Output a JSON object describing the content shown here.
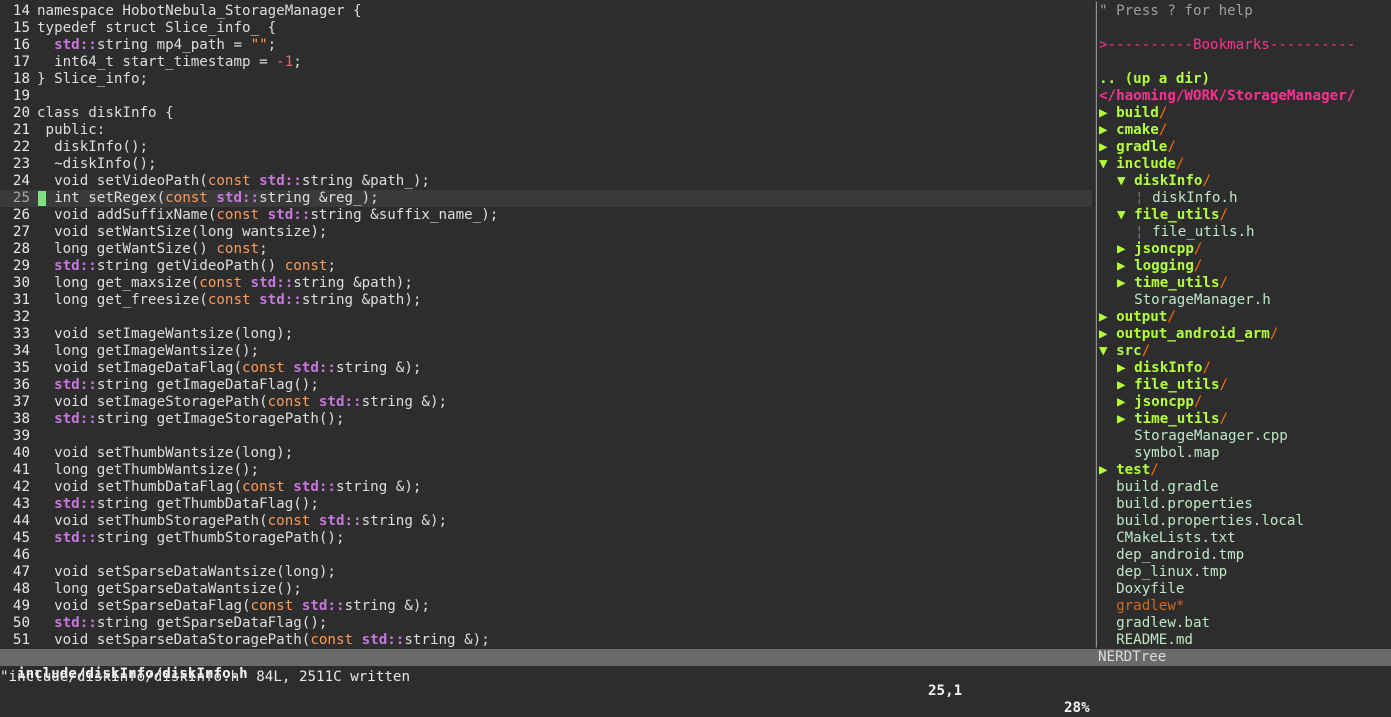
{
  "editor": {
    "current_line": 25,
    "lines": [
      {
        "n": "14",
        "code": "namespace HobotNebula_StorageManager {"
      },
      {
        "n": "15",
        "code": "typedef struct Slice_info_ {"
      },
      {
        "n": "16",
        "code": "  std::string mp4_path = \"\";"
      },
      {
        "n": "17",
        "code": "  int64_t start_timestamp = -1;"
      },
      {
        "n": "18",
        "code": "} Slice_info;"
      },
      {
        "n": "19",
        "code": ""
      },
      {
        "n": "20",
        "code": "class diskInfo {"
      },
      {
        "n": "21",
        "code": " public:"
      },
      {
        "n": "22",
        "code": "  diskInfo();"
      },
      {
        "n": "23",
        "code": "  ~diskInfo();"
      },
      {
        "n": "24",
        "code": "  void setVideoPath(const std::string &path_);"
      },
      {
        "n": "25",
        "code": "  int setRegex(const std::string &reg_);"
      },
      {
        "n": "26",
        "code": "  void addSuffixName(const std::string &suffix_name_);"
      },
      {
        "n": "27",
        "code": "  void setWantSize(long wantsize);"
      },
      {
        "n": "28",
        "code": "  long getWantSize() const;"
      },
      {
        "n": "29",
        "code": "  std::string getVideoPath() const;"
      },
      {
        "n": "30",
        "code": "  long get_maxsize(const std::string &path);"
      },
      {
        "n": "31",
        "code": "  long get_freesize(const std::string &path);"
      },
      {
        "n": "32",
        "code": ""
      },
      {
        "n": "33",
        "code": "  void setImageWantsize(long);"
      },
      {
        "n": "34",
        "code": "  long getImageWantsize();"
      },
      {
        "n": "35",
        "code": "  void setImageDataFlag(const std::string &);"
      },
      {
        "n": "36",
        "code": "  std::string getImageDataFlag();"
      },
      {
        "n": "37",
        "code": "  void setImageStoragePath(const std::string &);"
      },
      {
        "n": "38",
        "code": "  std::string getImageStoragePath();"
      },
      {
        "n": "39",
        "code": ""
      },
      {
        "n": "40",
        "code": "  void setThumbWantsize(long);"
      },
      {
        "n": "41",
        "code": "  long getThumbWantsize();"
      },
      {
        "n": "42",
        "code": "  void setThumbDataFlag(const std::string &);"
      },
      {
        "n": "43",
        "code": "  std::string getThumbDataFlag();"
      },
      {
        "n": "44",
        "code": "  void setThumbStoragePath(const std::string &);"
      },
      {
        "n": "45",
        "code": "  std::string getThumbStoragePath();"
      },
      {
        "n": "46",
        "code": ""
      },
      {
        "n": "47",
        "code": "  void setSparseDataWantsize(long);"
      },
      {
        "n": "48",
        "code": "  long getSparseDataWantsize();"
      },
      {
        "n": "49",
        "code": "  void setSparseDataFlag(const std::string &);"
      },
      {
        "n": "50",
        "code": "  std::string getSparseDataFlag();"
      },
      {
        "n": "51",
        "code": "  void setSparseDataStoragePath(const std::string &);"
      }
    ]
  },
  "tree": {
    "help": "\" Press ? for help",
    "bookmarks": ">----------Bookmarks----------",
    "up_dir": ".. (up a dir)",
    "root": "</haoming/WORK/StorageManager/",
    "items": [
      {
        "kind": "dir",
        "arrow": "▶",
        "name": "build",
        "depth": 0,
        "row": 6
      },
      {
        "kind": "dir",
        "arrow": "▶",
        "name": "cmake",
        "depth": 0,
        "row": 7
      },
      {
        "kind": "dir",
        "arrow": "▶",
        "name": "gradle",
        "depth": 0,
        "row": 8
      },
      {
        "kind": "dir",
        "arrow": "▼",
        "name": "include",
        "depth": 0,
        "row": 9
      },
      {
        "kind": "dir",
        "arrow": "▼",
        "name": "diskInfo",
        "depth": 1,
        "row": 10
      },
      {
        "kind": "file",
        "name": "diskInfo.h",
        "depth": 2,
        "row": 11,
        "guide": true
      },
      {
        "kind": "dir",
        "arrow": "▼",
        "name": "file_utils",
        "depth": 1,
        "row": 12
      },
      {
        "kind": "file",
        "name": "file_utils.h",
        "depth": 2,
        "row": 13,
        "guide": true
      },
      {
        "kind": "dir",
        "arrow": "▶",
        "name": "jsoncpp",
        "depth": 1,
        "row": 14
      },
      {
        "kind": "dir",
        "arrow": "▶",
        "name": "logging",
        "depth": 1,
        "row": 15
      },
      {
        "kind": "dir",
        "arrow": "▶",
        "name": "time_utils",
        "depth": 1,
        "row": 16
      },
      {
        "kind": "file",
        "name": "StorageManager.h",
        "depth": 1,
        "row": 17
      },
      {
        "kind": "dir",
        "arrow": "▶",
        "name": "output",
        "depth": 0,
        "row": 18
      },
      {
        "kind": "dir",
        "arrow": "▶",
        "name": "output_android_arm",
        "depth": 0,
        "row": 19
      },
      {
        "kind": "dir",
        "arrow": "▼",
        "name": "src",
        "depth": 0,
        "row": 20
      },
      {
        "kind": "dir",
        "arrow": "▶",
        "name": "diskInfo",
        "depth": 1,
        "row": 21
      },
      {
        "kind": "dir",
        "arrow": "▶",
        "name": "file_utils",
        "depth": 1,
        "row": 22
      },
      {
        "kind": "dir",
        "arrow": "▶",
        "name": "jsoncpp",
        "depth": 1,
        "row": 23
      },
      {
        "kind": "dir",
        "arrow": "▶",
        "name": "time_utils",
        "depth": 1,
        "row": 24
      },
      {
        "kind": "file",
        "name": "StorageManager.cpp",
        "depth": 1,
        "row": 25
      },
      {
        "kind": "file",
        "name": "symbol.map",
        "depth": 1,
        "row": 26
      },
      {
        "kind": "dir",
        "arrow": "▶",
        "name": "test",
        "depth": 0,
        "row": 27
      },
      {
        "kind": "file",
        "name": "build.gradle",
        "depth": 0,
        "row": 28
      },
      {
        "kind": "file",
        "name": "build.properties",
        "depth": 0,
        "row": 29
      },
      {
        "kind": "file",
        "name": "build.properties.local",
        "depth": 0,
        "row": 30
      },
      {
        "kind": "file",
        "name": "CMakeLists.txt",
        "depth": 0,
        "row": 31
      },
      {
        "kind": "file",
        "name": "dep_android.tmp",
        "depth": 0,
        "row": 32
      },
      {
        "kind": "file",
        "name": "dep_linux.tmp",
        "depth": 0,
        "row": 33
      },
      {
        "kind": "file",
        "name": "Doxyfile",
        "depth": 0,
        "row": 34
      },
      {
        "kind": "exe",
        "name": "gradlew*",
        "depth": 0,
        "row": 35
      },
      {
        "kind": "file",
        "name": "gradlew.bat",
        "depth": 0,
        "row": 36
      },
      {
        "kind": "file",
        "name": "README.md",
        "depth": 0,
        "row": 37
      }
    ]
  },
  "status": {
    "file": "include/diskInfo/diskInfo.h",
    "position": "25,1",
    "percent": "28%",
    "nerdtree": "NERDTree"
  },
  "cmdline": "\"include/diskInfo/diskInfo.h\" 84L, 2511C written",
  "colors": {
    "background": "#2d2d2d",
    "keyword": "#7aa2f7",
    "namespace": "#c678dd",
    "directory": "#b4ff3c",
    "bookmark": "#ff2f92",
    "statusbar": "#6a6a6a"
  }
}
